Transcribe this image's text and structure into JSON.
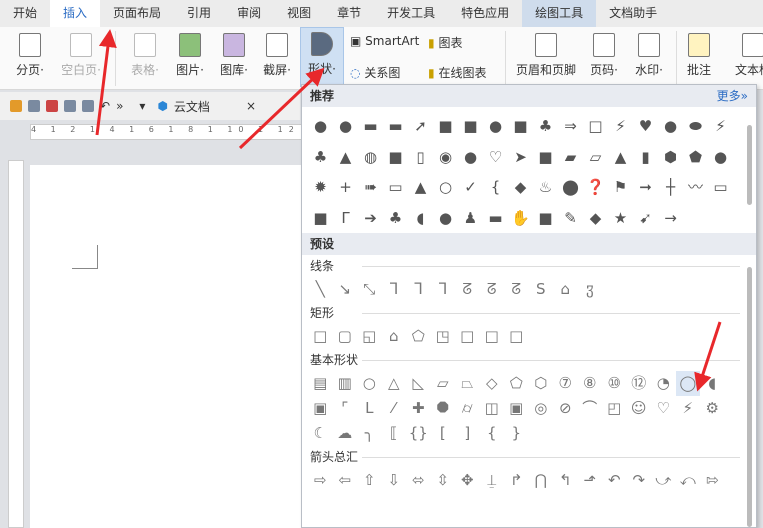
{
  "tabs": [
    "开始",
    "插入",
    "页面布局",
    "引用",
    "审阅",
    "视图",
    "章节",
    "开发工具",
    "特色应用",
    "绘图工具",
    "文档助手"
  ],
  "ribbon": {
    "page_break": "分页·",
    "blank_page": "空白页·",
    "table": "表格·",
    "picture": "图片·",
    "gallery": "图库·",
    "screenshot": "截屏·",
    "shapes": "形状·",
    "smartart": "SmartArt",
    "chart": "图表",
    "relation": "关系图",
    "online_chart": "在线图表",
    "header_footer": "页眉和页脚",
    "page_num": "页码·",
    "watermark": "水印·",
    "comment": "批注",
    "textbox": "文本框"
  },
  "qat": {
    "cloud_doc": "云文档"
  },
  "ruler": "4 1 2 1 4 1 6 1 8 1 10 1 12",
  "dropdown": {
    "recommended": "推荐",
    "more": "更多»",
    "presets": "预设",
    "rec_shapes": [
      "●",
      "●",
      "▬",
      "▬",
      "➚",
      "■",
      "■",
      "●",
      "■",
      "♣",
      "⇒",
      "□",
      "⚡",
      "♥",
      "●",
      "⬬",
      "⚡",
      "♣",
      "▲",
      "◍",
      "■",
      "▯",
      "◉",
      "●",
      "♡",
      "➤",
      "■",
      "▰",
      "▱",
      "▲",
      "▮",
      "⬢",
      "⬟",
      "●",
      "✹",
      "+",
      "➠",
      "▭",
      "▲",
      "○",
      "✓",
      "{",
      "◆",
      "♨",
      "⬤",
      "❓",
      "⚑",
      "➞",
      "┼",
      "〰",
      "▭",
      "■",
      "Γ",
      "➔",
      "♣",
      "◖",
      "●",
      "♟",
      "▬",
      "✋",
      "■",
      "✎",
      "◆",
      "★",
      "➹",
      "→"
    ],
    "sections": [
      {
        "title": "线条",
        "shapes": [
          "╲",
          "↘",
          "⤡",
          "ᒣ",
          "ᒣ",
          "ᒣ",
          "ᘔ",
          "ᘔ",
          "ᘔ",
          "S",
          "⌂",
          "ჳ"
        ]
      },
      {
        "title": "矩形",
        "shapes": [
          "□",
          "▢",
          "◱",
          "⌂",
          "⬠",
          "◳",
          "□",
          "□",
          "□"
        ]
      },
      {
        "title": "基本形状",
        "shapes": [
          "▤",
          "▥",
          "○",
          "△",
          "◺",
          "▱",
          "⏢",
          "◇",
          "⬠",
          "⬡",
          "⑦",
          "⑧",
          "⑩",
          "⑫",
          "◔",
          "◯",
          "◖",
          "▣",
          "⌜",
          "L",
          "⁄",
          "✚",
          "⯃",
          "⌭",
          "◫",
          "▣",
          "◎",
          "⊘",
          "⌒",
          "◰",
          "☺",
          "♡",
          "⚡",
          "⚙",
          "☾",
          "☁",
          "╮",
          "⟦",
          "{}",
          "[",
          "]",
          "{",
          "}"
        ]
      },
      {
        "title": "箭头总汇",
        "shapes": [
          "⇨",
          "⇦",
          "⇧",
          "⇩",
          "⬄",
          "⇳",
          "✥",
          "⍊",
          "↱",
          "⋂",
          "↰",
          "⬏",
          "↶",
          "↷",
          "⤻",
          "⤺",
          "⇰"
        ]
      }
    ]
  },
  "colors": {
    "accent": "#2b6cc4",
    "arrow": "#e8282b"
  }
}
